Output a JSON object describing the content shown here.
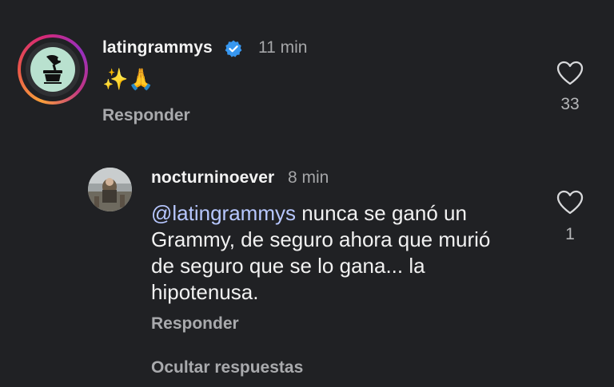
{
  "comment": {
    "username": "latingrammys",
    "time": "11 min",
    "text": "✨🙏",
    "reply_label": "Responder",
    "likes": "33",
    "verified": true,
    "avatar_icon": "gramophone-icon",
    "like_icon": "heart-icon"
  },
  "reply": {
    "username": "nocturninoever",
    "time": "8 min",
    "mention": "@latingrammys",
    "line1_rest": " nunca se ganó un",
    "line2": "Grammy, de seguro ahora que murió",
    "line3": "de seguro que se lo gana... la",
    "line4": "hipotenusa.",
    "reply_label": "Responder",
    "likes": "1",
    "like_icon": "heart-icon"
  },
  "thread": {
    "hide_replies_label": "Ocultar respuestas"
  },
  "colors": {
    "background": "#202124",
    "mention": "#b7c7ff",
    "verified": "#3797f0"
  }
}
